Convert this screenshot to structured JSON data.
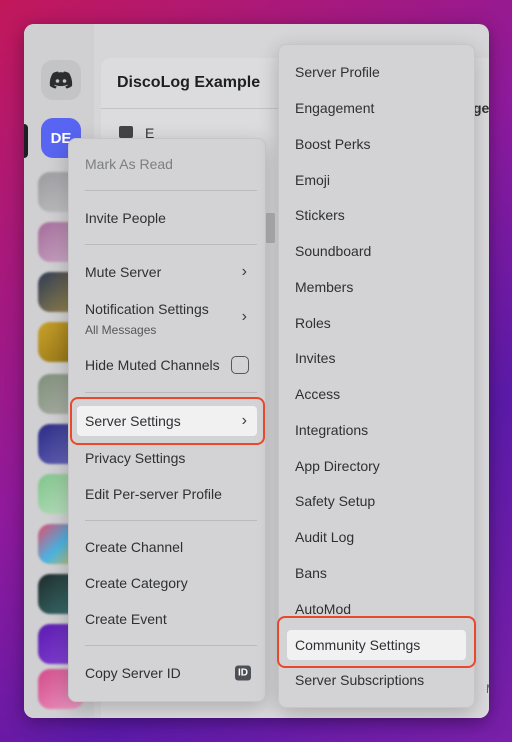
{
  "server": {
    "name": "DiscoLog Example",
    "icon_initials": "DE"
  },
  "context_menu": {
    "mark_as_read": "Mark As Read",
    "invite_people": "Invite People",
    "mute_server": "Mute Server",
    "notification_settings": "Notification Settings",
    "notification_sub": "All Messages",
    "hide_muted": "Hide Muted Channels",
    "server_settings": "Server Settings",
    "privacy_settings": "Privacy Settings",
    "edit_profile": "Edit Per-server Profile",
    "create_channel": "Create Channel",
    "create_category": "Create Category",
    "create_event": "Create Event",
    "copy_id": "Copy Server ID",
    "id_badge": "ID"
  },
  "submenu": {
    "items": [
      "Server Profile",
      "Engagement",
      "Boost Perks",
      "Emoji",
      "Stickers",
      "Soundboard",
      "Members",
      "Roles",
      "Invites",
      "Access",
      "Integrations",
      "App Directory",
      "Safety Setup",
      "Audit Log",
      "Bans",
      "AutoMod",
      "Community Settings",
      "Server Subscriptions"
    ]
  },
  "colors": {
    "accent": "#5865f2",
    "highlight_outline": "#e8482c"
  }
}
